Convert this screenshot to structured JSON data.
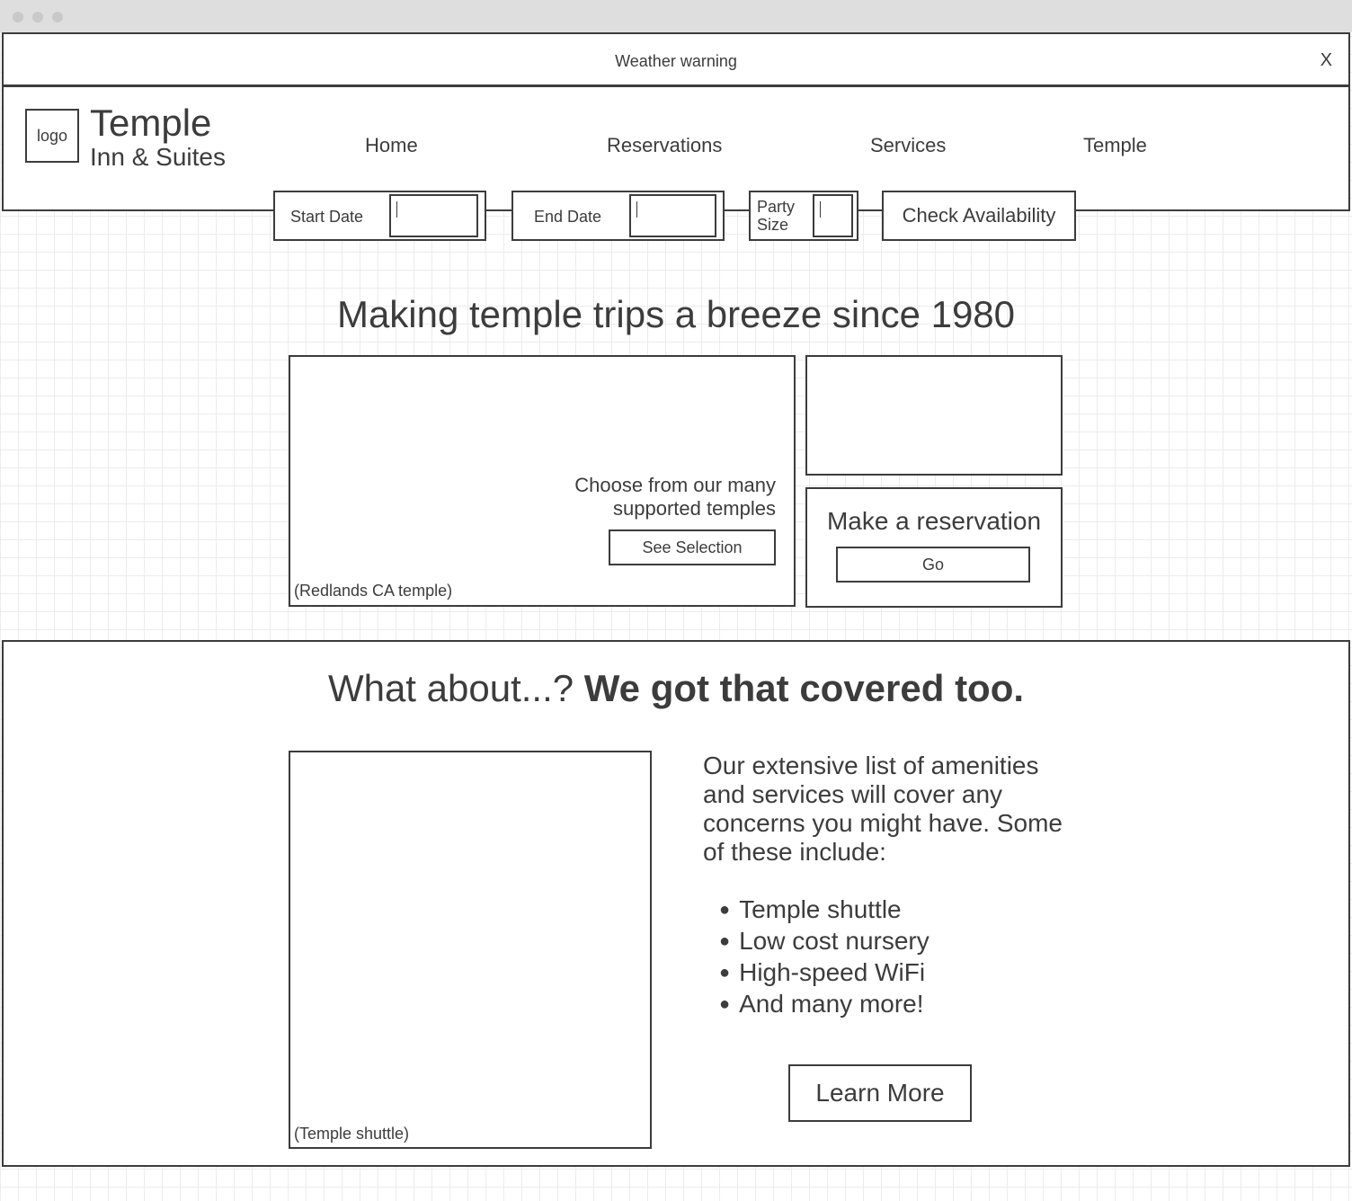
{
  "banner": {
    "text": "Weather warning",
    "close_label": "X"
  },
  "brand": {
    "logo_text": "logo",
    "title": "Temple",
    "subtitle": "Inn & Suites"
  },
  "nav": {
    "items": [
      {
        "label": "Home"
      },
      {
        "label": "Reservations"
      },
      {
        "label": "Services"
      },
      {
        "label": "Temple"
      }
    ]
  },
  "booking": {
    "start_date_label": "Start Date",
    "start_date_value": "",
    "end_date_label": "End Date",
    "end_date_value": "",
    "party_size_label_line1": "Party",
    "party_size_label_line2": "Size",
    "party_size_value": "",
    "check_button": "Check Availability"
  },
  "hero": {
    "title": "Making temple trips a breeze since 1980",
    "temples_text_line1": "Choose from our many",
    "temples_text_line2": "supported temples",
    "see_selection_button": "See Selection",
    "image_caption": "(Redlands CA temple)",
    "reservation_title": "Make a reservation",
    "go_button": "Go"
  },
  "amenities": {
    "heading_plain": "What about...? ",
    "heading_bold": "We got that covered too.",
    "image_caption": "(Temple shuttle)",
    "description": "Our extensive list of amenities and services will cover any concerns you might have. Some of these include:",
    "items": [
      "Temple shuttle",
      "Low cost nursery",
      "High-speed WiFi",
      "And many more!"
    ],
    "learn_more_button": "Learn More"
  }
}
